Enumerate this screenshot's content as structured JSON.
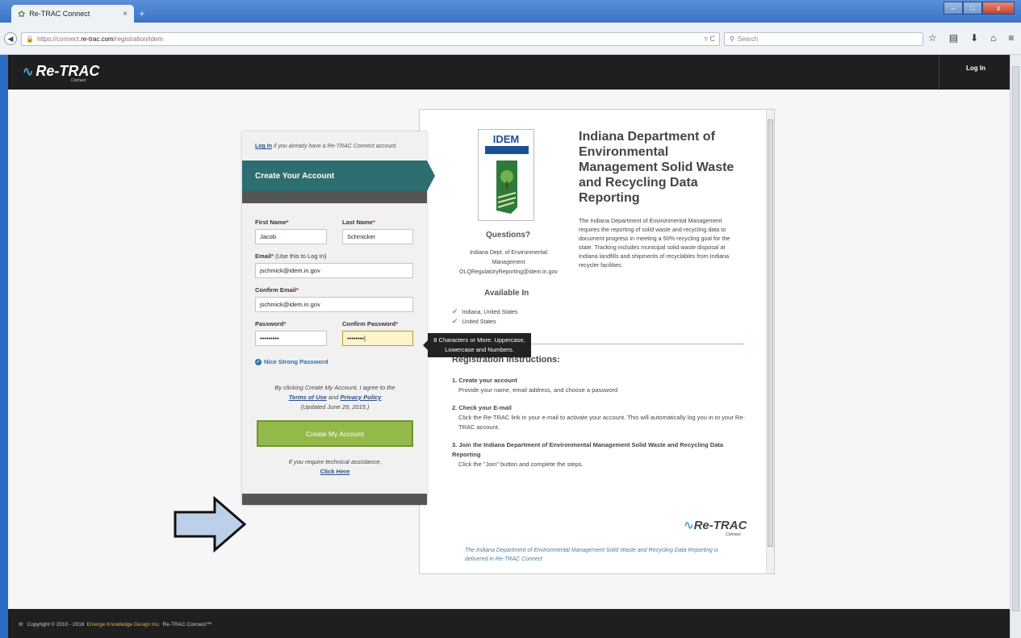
{
  "browser": {
    "tab_title": "Re-TRAC Connect",
    "tab_close": "×",
    "new_tab": "+",
    "url_prefix": "https://connect.",
    "url_host": "re-trac.com",
    "url_path": "/registration/idem",
    "search_placeholder": "Search",
    "win_min": "–",
    "win_max": "□",
    "win_close": "x"
  },
  "header": {
    "logo_text": "Re-TRAC",
    "logo_sub": "Connect",
    "login_label": "Log In"
  },
  "registration": {
    "login_link": "Log In",
    "login_hint": " if you already have a Re-TRAC Connect account.",
    "banner_title": "Create Your Account",
    "first_name_label": "First Name",
    "first_name_value": "Jacob",
    "last_name_label": "Last Name",
    "last_name_value": "Schmicker",
    "email_label": "Email",
    "email_note": " (Use this to Log In)",
    "email_value": "jschmick@idem.in.gov",
    "confirm_email_label": "Confirm Email",
    "confirm_email_value": "jschmick@idem.in.gov",
    "password_label": "Password",
    "password_value": "•••••••••",
    "confirm_password_label": "Confirm Password",
    "confirm_password_value": "••••••••|",
    "required_mark": "*",
    "strength_text": "Nice Strong Password",
    "agree_text": "By clicking Create My Account, I agree to the",
    "terms_link": "Terms of Use",
    "and_text": " and ",
    "privacy_link": "Privacy Policy",
    "updated_text": "(Updated June 29, 2015.)",
    "create_button": "Create My Account",
    "assist_text": "If you require technical assistance,",
    "click_here": "Click Here"
  },
  "tooltip": {
    "line1": "8 Characters or More. Uppercase,",
    "line2": "Lowercase and Numbers."
  },
  "program": {
    "logo_text": "IDEM",
    "title": "Indiana Department of Environmental Management Solid Waste and Recycling Data Reporting",
    "description": "The Indiana Department of Environmental Management requires the reporting of solid waste and recycling data to document progress in meeting a 50% recycling goal for the state. Tracking includes municipal solid waste disposal at Indiana landfills and shipments of recyclables from Indiana recycler facilities.",
    "questions_title": "Questions?",
    "questions_org1": "Indiana Dept. of Environmental",
    "questions_org2": "Management",
    "questions_email": "OLQRegulatoryReporting@idem.in.gov",
    "available_title": "Available In",
    "available": [
      "Indiana, United States",
      "United States"
    ],
    "instructions_title": "Registration Instructions:",
    "steps": [
      {
        "title": "1. Create your account",
        "desc": "Provide your name, email address, and choose a password"
      },
      {
        "title": "2. Check your E-mail",
        "desc": "Click the Re-TRAC link in your e-mail to activate your account. This will automatically log you in to your Re-TRAC account."
      },
      {
        "title": "3. Join the Indiana Department of Environmental Management Solid Waste and Recycling Data Reporting",
        "desc": "Click the \"Join\" button and complete the steps."
      }
    ],
    "footer_logo": "Re-TRAC",
    "footer_logo_sub": "Connect",
    "delivered_text": "The Indiana Department of Environmental Management Solid Waste and Recycling Data Reporting is delivered in Re-TRAC Connect"
  },
  "footer": {
    "copyright": "Copyright © 2010 - 2016",
    "company": "Emerge Knowledge Design Inc.",
    "product": "Re-TRAC Connect™"
  }
}
